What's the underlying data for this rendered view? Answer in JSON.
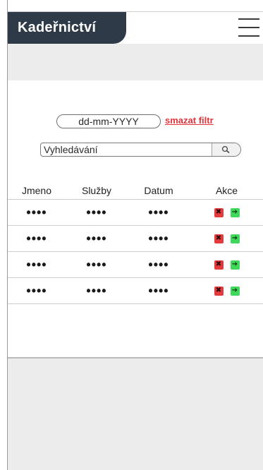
{
  "header": {
    "title": "Kadeřnictví",
    "menu_icon": "hamburger-menu-icon"
  },
  "filter": {
    "date_placeholder": "dd-mm-YYYY",
    "clear_label": "smazat filtr"
  },
  "search": {
    "placeholder": "Vyhledávání",
    "icon": "search-icon"
  },
  "table": {
    "columns": [
      "Jmeno",
      "Služby",
      "Datum",
      "Akce"
    ],
    "rows": [
      {
        "jmeno": "••••",
        "sluzby": "••••",
        "datum": "••••"
      },
      {
        "jmeno": "••••",
        "sluzby": "••••",
        "datum": "••••"
      },
      {
        "jmeno": "••••",
        "sluzby": "••••",
        "datum": "••••"
      },
      {
        "jmeno": "••••",
        "sluzby": "••••",
        "datum": "••••"
      }
    ],
    "action_icons": {
      "delete": "x-icon",
      "open": "arrow-right-icon"
    },
    "delete_glyph": "✖",
    "open_glyph": "➔"
  },
  "colors": {
    "brand_bg": "#2f3a48",
    "clear_filter": "#e0333a",
    "delete_action": "#e33b3b",
    "open_action": "#3fd85a",
    "band_grey": "#ececec"
  }
}
